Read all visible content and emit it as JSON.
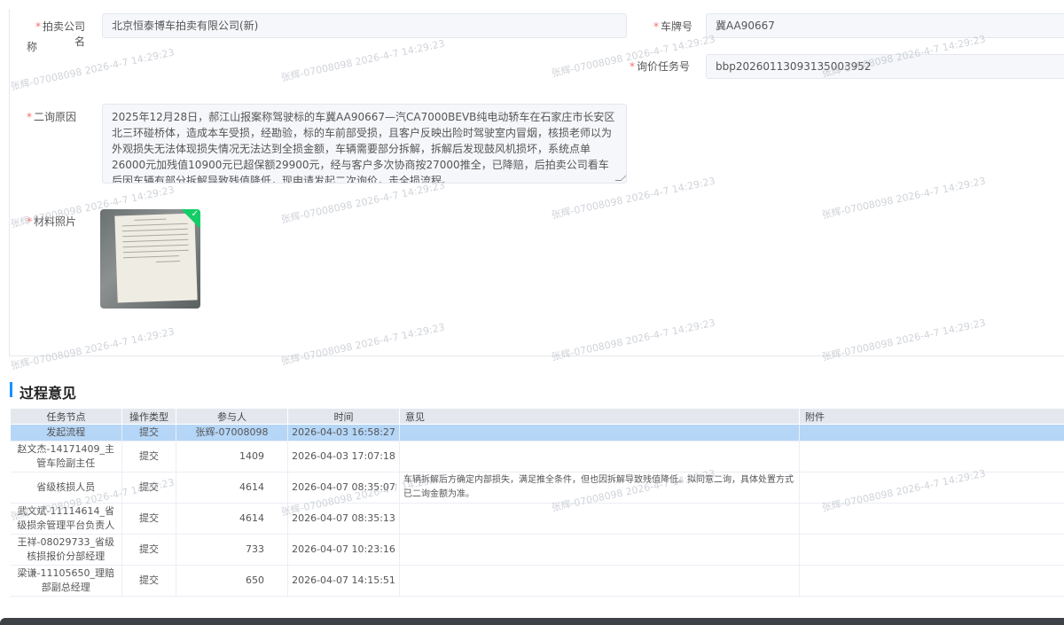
{
  "form": {
    "company_label": "拍卖公司名",
    "company_label_wrap": "称",
    "company_value": "北京恒泰博车拍卖有限公司(新)",
    "plate_label": "车牌号",
    "plate_value": "冀AA90667",
    "task_label": "询价任务号",
    "task_value": "bbp20260113093135003952",
    "reason_label": "二询原因",
    "reason_text": "2025年12月28日，郝江山报案称驾驶标的车冀AA90667—汽CA7000BEVB纯电动轿车在石家庄市长安区北三环碰桥体，造成本车受损，经勘验，标的车前部受损，且客户反映出险时驾驶室内冒烟，核损老师以为外观损失无法体现损失情况无法达到全损金额，车辆需要部分拆解，拆解后发现鼓风机损坏，系统点单26000元加残值10900元已超保额29900元，经与客户多次协商按27000推全，已降赔，后拍卖公司看车后因车辆有部分拆解导致残值降低，现申请发起二次询价，走全损流程。",
    "photo_label": "材料照片"
  },
  "section_title": "过程意见",
  "table": {
    "headers": [
      "任务节点",
      "操作类型",
      "参与人",
      "时间",
      "意见",
      "附件"
    ],
    "rows": [
      {
        "node": "发起流程",
        "op": "提交",
        "person": "张辉-07008098",
        "time": "2026-04-03 16:58:27",
        "opinion": "",
        "attach": ""
      },
      {
        "node": "赵文杰-14171409_主管车险副主任",
        "op": "提交",
        "person": "1409",
        "time": "2026-04-03 17:07:18",
        "opinion": "",
        "attach": ""
      },
      {
        "node": "省级核损人员",
        "op": "提交",
        "person": "4614",
        "time": "2026-04-07 08:35:07",
        "opinion": "车辆拆解后方确定内部损失，满足推全条件，但也因拆解导致残值降低。拟同意二询，具体处置方式已二询金额为准。",
        "attach": ""
      },
      {
        "node": "武文斌-11114614_省级损余管理平台负责人",
        "op": "提交",
        "person": "4614",
        "time": "2026-04-07 08:35:13",
        "opinion": "",
        "attach": ""
      },
      {
        "node": "王祥-08029733_省级核损报价分部经理",
        "op": "提交",
        "person": "733",
        "time": "2026-04-07 10:23:16",
        "opinion": "",
        "attach": ""
      },
      {
        "node": "梁谦-11105650_理赔部副总经理",
        "op": "提交",
        "person": "650",
        "time": "2026-04-07 14:15:51",
        "opinion": "",
        "attach": ""
      }
    ]
  },
  "watermark": {
    "a": "张辉-07008098",
    "b": "2026-4-7 14:29:23"
  }
}
